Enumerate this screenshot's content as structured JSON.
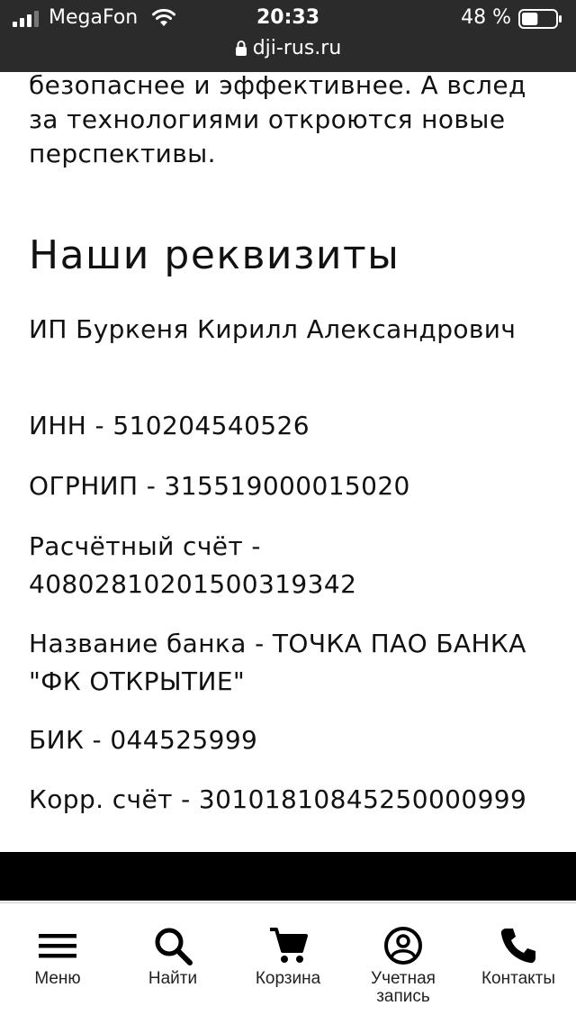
{
  "status_bar": {
    "carrier": "MegaFon",
    "time": "20:33",
    "battery": "48 %",
    "battery_level": 0.48
  },
  "url_bar": {
    "url": "dji-rus.ru"
  },
  "main": {
    "intro_text": "безопаснее и эффективнее. А вслед за технологиями откроются новые перспективы.",
    "section_title": "Наши реквизиты",
    "requisites": {
      "owner": "ИП Буркеня Кирилл Александрович",
      "inn": "ИНН - 510204540526",
      "ogrnip": "ОГРНИП - 315519000015020",
      "account": "Расчётный счёт - 40802810201500319342",
      "bank": "Название банка - ТОЧКА ПАО БАНКА \"ФК ОТКРЫТИЕ\"",
      "bik": "БИК - 044525999",
      "corr_account": "Корр. счёт - 30101810845250000999"
    }
  },
  "bottom_nav": {
    "items": [
      {
        "label": "Меню",
        "icon": "menu-icon"
      },
      {
        "label": "Найти",
        "icon": "search-icon"
      },
      {
        "label": "Корзина",
        "icon": "cart-icon"
      },
      {
        "label": "Учетная запись",
        "icon": "account-icon"
      },
      {
        "label": "Контакты",
        "icon": "phone-icon"
      }
    ]
  }
}
